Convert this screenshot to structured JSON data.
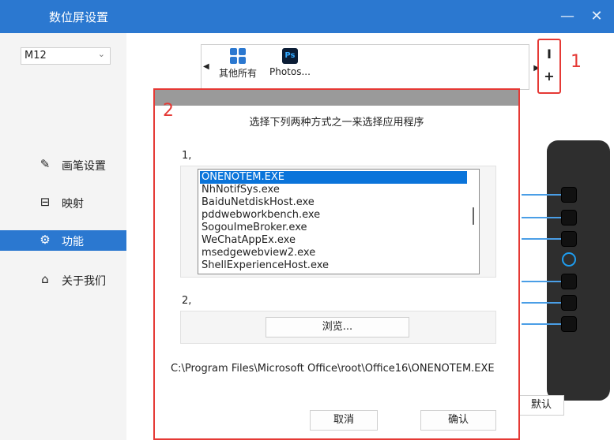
{
  "window": {
    "title": "数位屏设置",
    "minimize_label": "—",
    "close_label": "✕",
    "accent_color": "#2b78d0"
  },
  "sidebar": {
    "device_select": {
      "value": "M12",
      "caret": "⌄"
    },
    "items": [
      {
        "label": "画笔设置",
        "icon": "pen-icon",
        "glyph": "✎",
        "active": false
      },
      {
        "label": "映射",
        "icon": "monitor-icon",
        "glyph": "⊟",
        "active": false
      },
      {
        "label": "功能",
        "icon": "gear-icon",
        "glyph": "⚙",
        "active": true
      },
      {
        "label": "关于我们",
        "icon": "home-icon",
        "glyph": "⌂",
        "active": false
      }
    ]
  },
  "app_strip": {
    "left_arrow": "◀",
    "right_arrow": "▶",
    "apps": [
      {
        "name": "其他所有",
        "icon": "all-apps-icon"
      },
      {
        "name": "Photos...",
        "icon": "photoshop-icon",
        "icon_text": "Ps"
      }
    ]
  },
  "side_buttons": {
    "top": "I",
    "add": "+"
  },
  "annotations": {
    "one": "1",
    "two": "2",
    "color": "#e53935"
  },
  "default_button": "默认",
  "dialog": {
    "title": "选择下列两种方式之一来选择应用程序",
    "section1": "1,",
    "section2": "2,",
    "processes": [
      "ONENOTEM.EXE",
      "NhNotifSys.exe",
      "BaiduNetdiskHost.exe",
      "pddwebworkbench.exe",
      "SogouImeBroker.exe",
      "WeChatAppEx.exe",
      "msedgewebview2.exe",
      "ShellExperienceHost.exe"
    ],
    "selected_index": 0,
    "browse_label": "浏览...",
    "path": "C:\\Program Files\\Microsoft Office\\root\\Office16\\ONENOTEM.EXE",
    "cancel_label": "取消",
    "confirm_label": "确认"
  }
}
